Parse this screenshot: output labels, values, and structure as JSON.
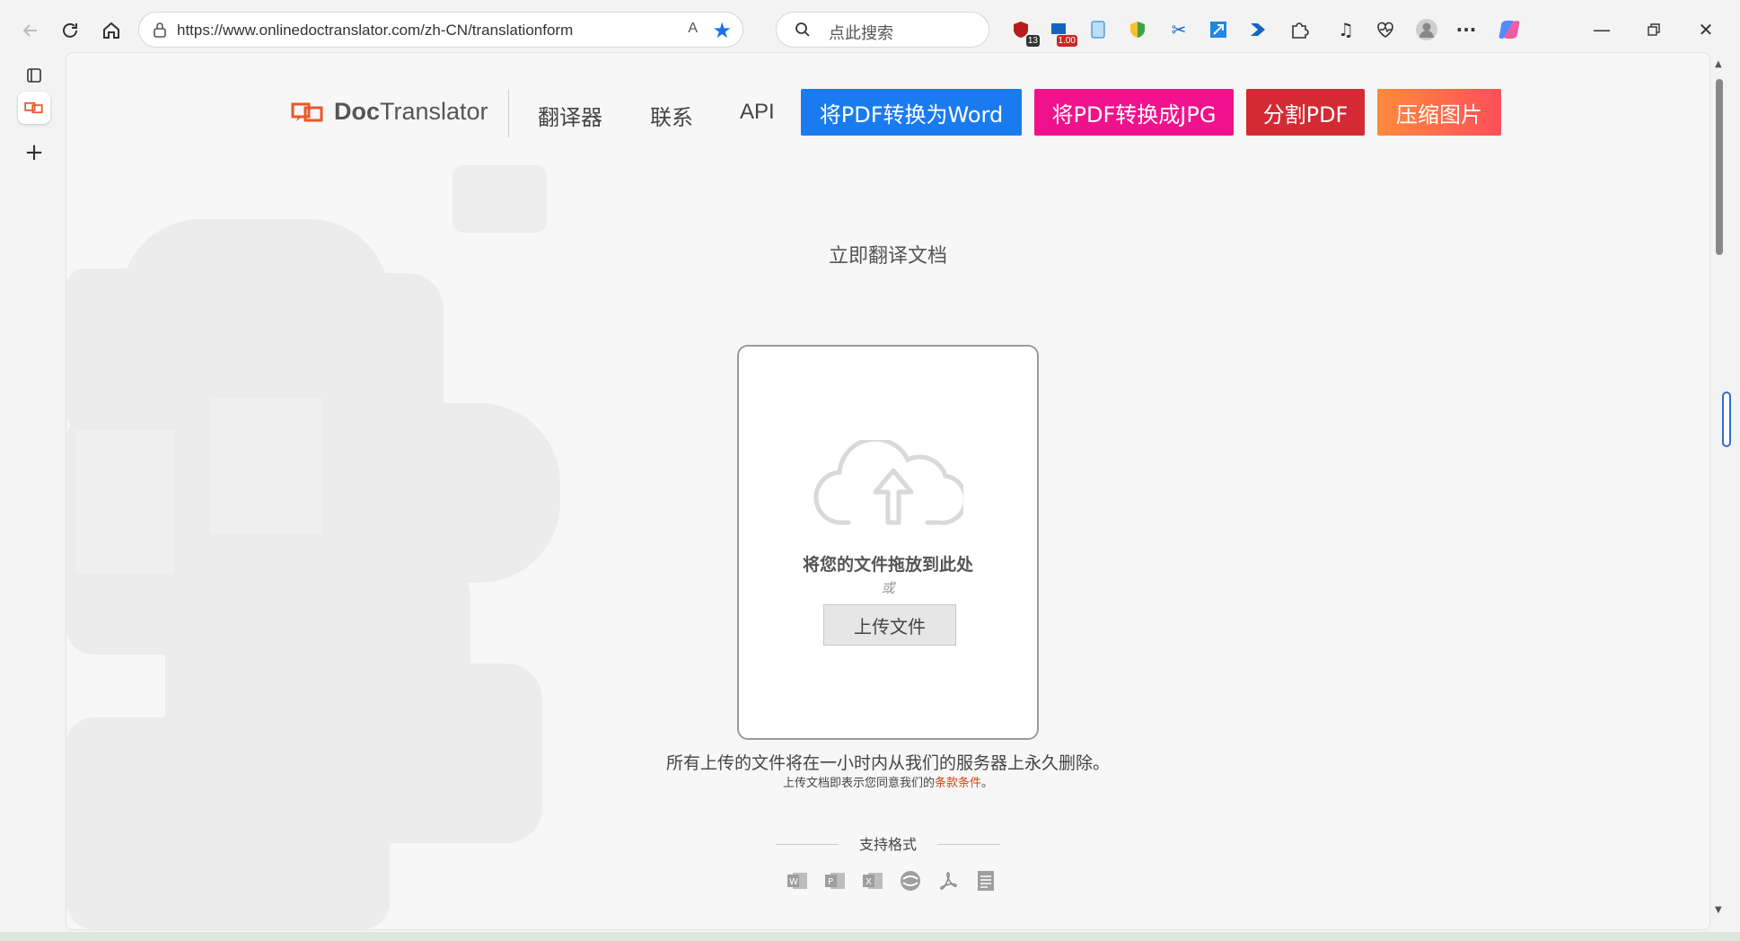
{
  "browser": {
    "url": "https://www.onlinedoctranslator.com/zh-CN/translationform",
    "read_aloud_label": "A",
    "search_placeholder": "点此搜索",
    "extensions": [
      {
        "name": "shield-extension",
        "badge": "13"
      },
      {
        "name": "flag-extension",
        "badge": "1.00"
      },
      {
        "name": "doc-extension",
        "badge": ""
      },
      {
        "name": "color-extension",
        "badge": ""
      },
      {
        "name": "scissors-extension",
        "badge": ""
      },
      {
        "name": "resize-extension",
        "badge": ""
      },
      {
        "name": "arrow-extension",
        "badge": ""
      }
    ],
    "more_label": "···"
  },
  "site": {
    "logo": {
      "bold": "Doc",
      "rest": "Translator"
    },
    "nav": [
      {
        "label": "翻译器"
      },
      {
        "label": "联系"
      },
      {
        "label": "API"
      }
    ],
    "ctas": [
      {
        "label": "将PDF转换为Word",
        "color": "#1a7bf0"
      },
      {
        "label": "将PDF转换成JPG",
        "color": "#f0128c"
      },
      {
        "label": "分割PDF",
        "color": "#d42a33"
      },
      {
        "label": "压缩图片",
        "color": "#ff6e4a"
      }
    ]
  },
  "main": {
    "headline": "立即翻译文档",
    "drop_text": "将您的文件拖放到此处",
    "or_text": "或",
    "upload_button": "上传文件",
    "notice": "所有上传的文件将在一小时内从我们的服务器上永久删除。",
    "terms_prefix": "上传文档即表示您同意我们的",
    "terms_link": "条款条件",
    "terms_suffix": "。",
    "formats_title": "支持格式",
    "formats": [
      "word-icon",
      "powerpoint-icon",
      "excel-icon",
      "openoffice-icon",
      "pdf-icon",
      "text-file-icon"
    ]
  }
}
